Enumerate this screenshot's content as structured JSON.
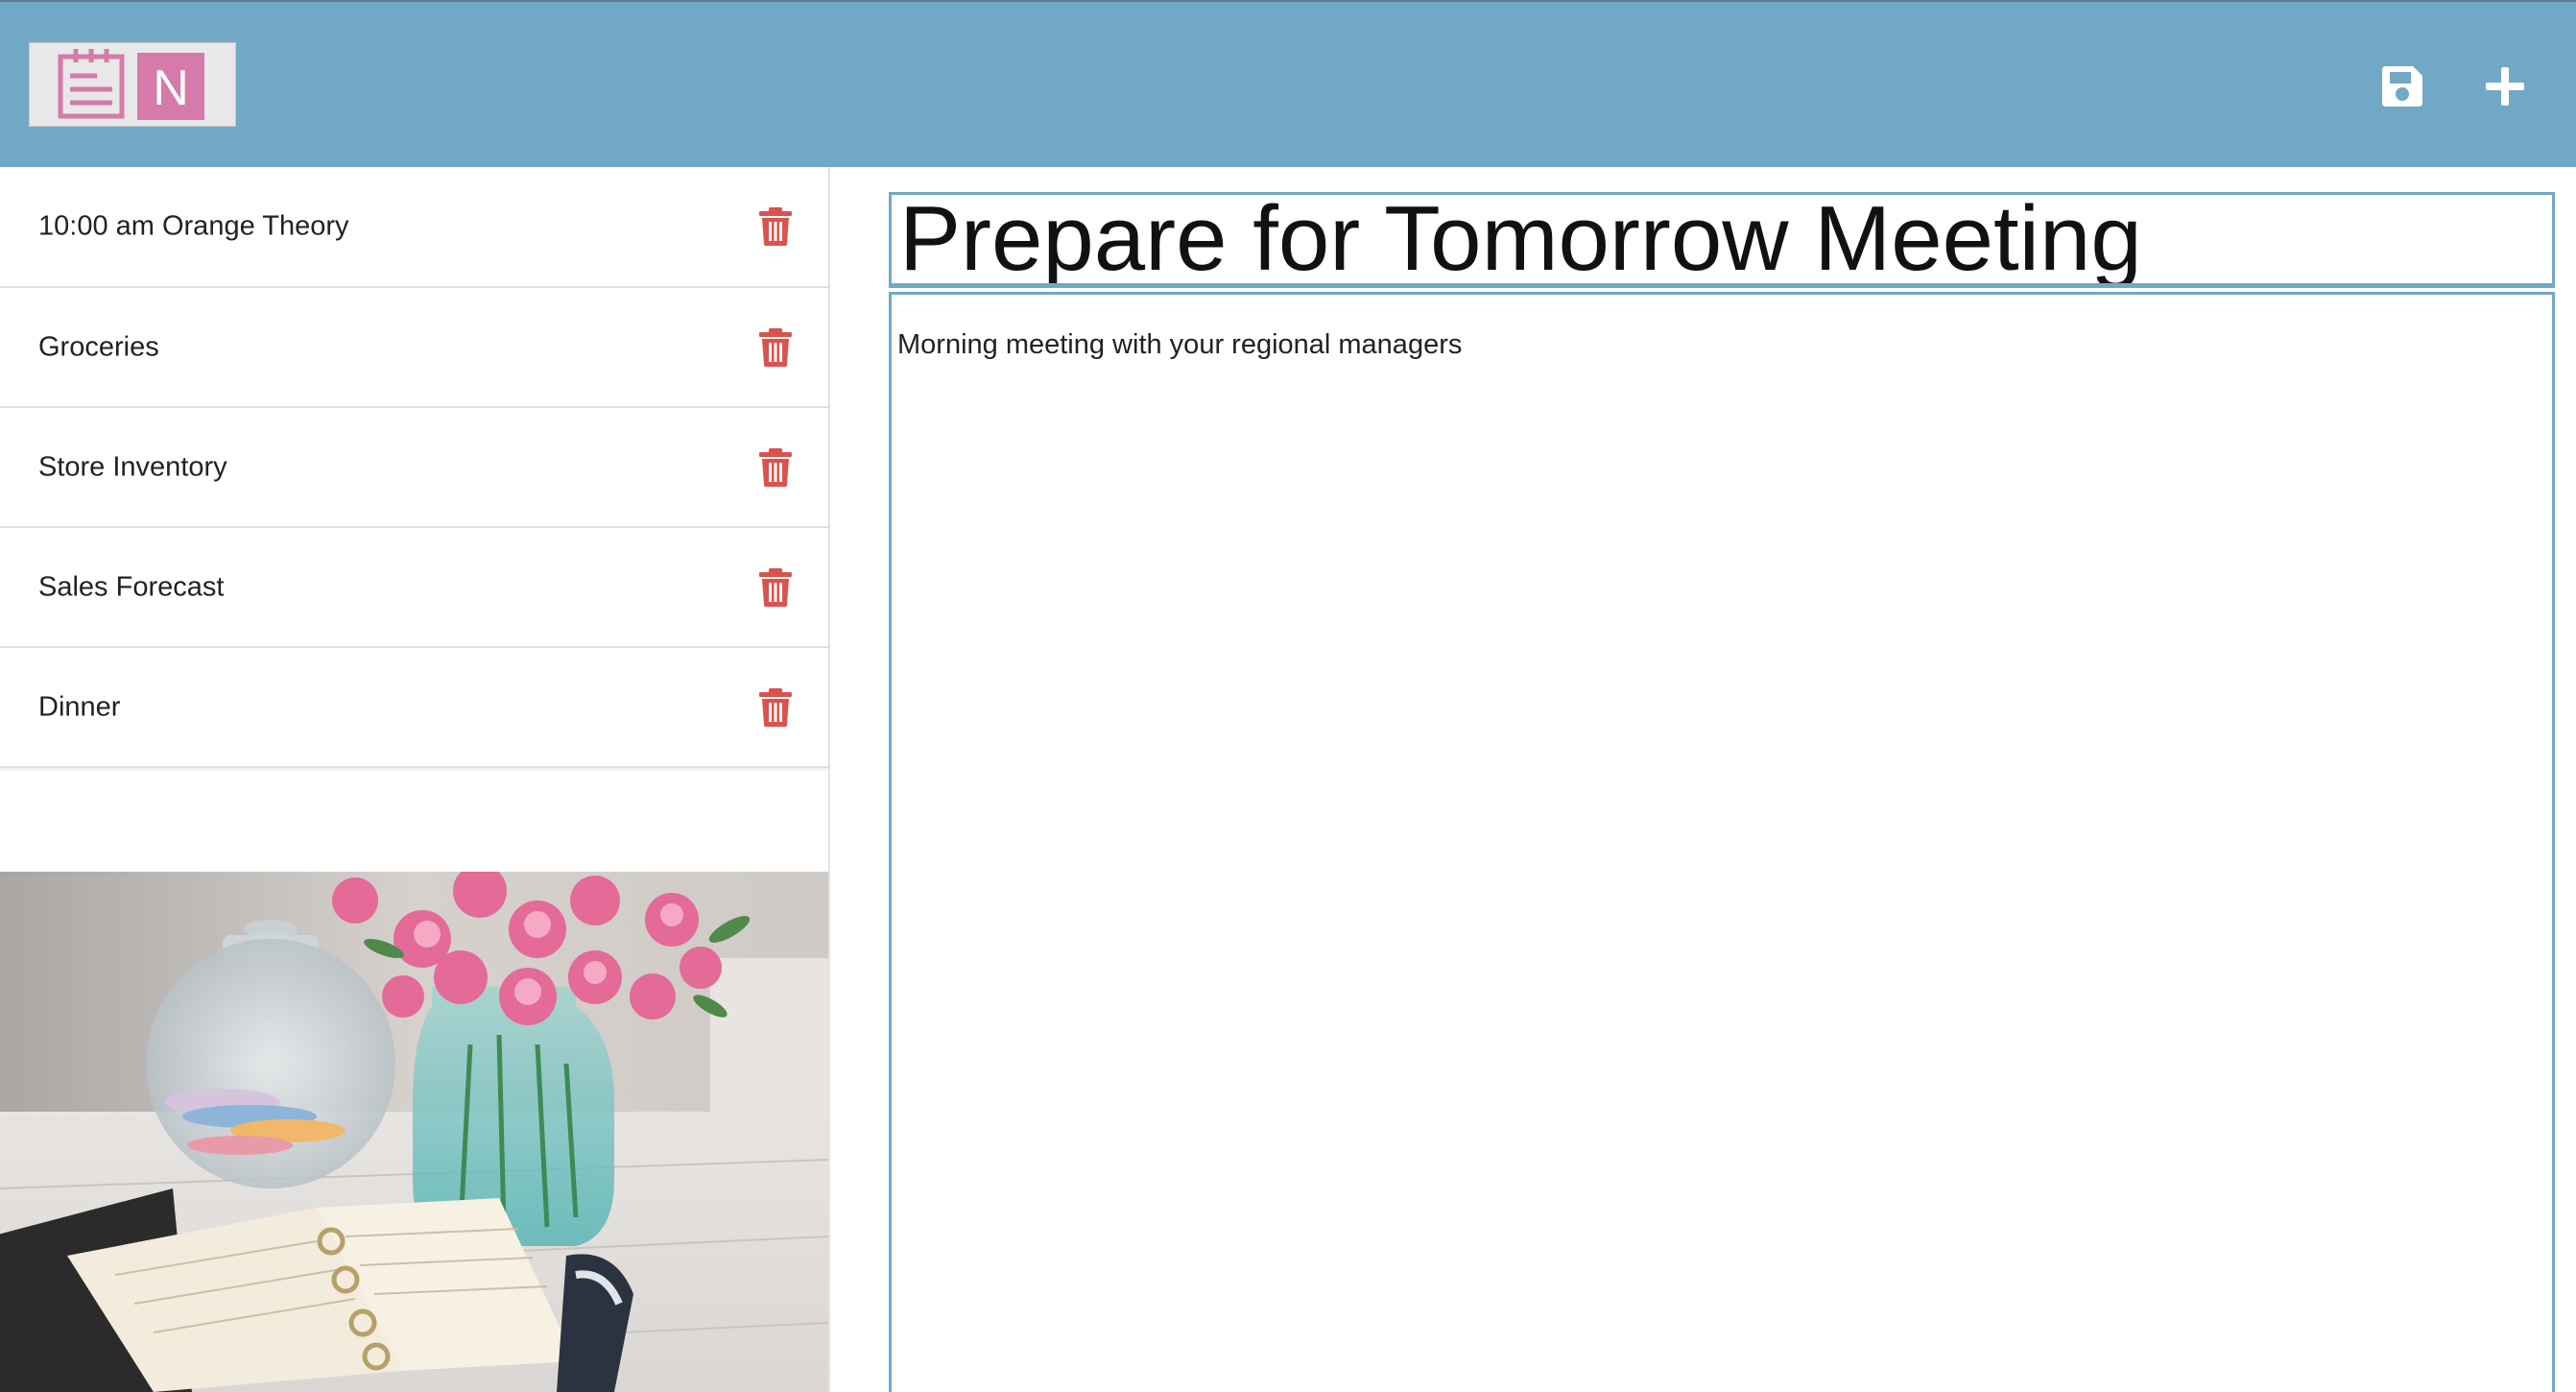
{
  "header": {
    "logo_letter": "N",
    "save_icon": "floppy-disk-icon",
    "add_icon": "plus-icon",
    "accent_color": "#71a8c6",
    "logo_color": "#d57aa9"
  },
  "sidebar": {
    "notes": [
      {
        "title": "10:00 am Orange Theory",
        "delete_icon": "trash-icon"
      },
      {
        "title": "Groceries",
        "delete_icon": "trash-icon"
      },
      {
        "title": "Store Inventory",
        "delete_icon": "trash-icon"
      },
      {
        "title": "Sales Forecast",
        "delete_icon": "trash-icon"
      },
      {
        "title": "Dinner",
        "delete_icon": "trash-icon"
      }
    ],
    "delete_color": "#d9534f"
  },
  "editor": {
    "title_value": "Prepare for Tomorrow Meeting",
    "body_value": "Morning meeting with your regional managers"
  }
}
